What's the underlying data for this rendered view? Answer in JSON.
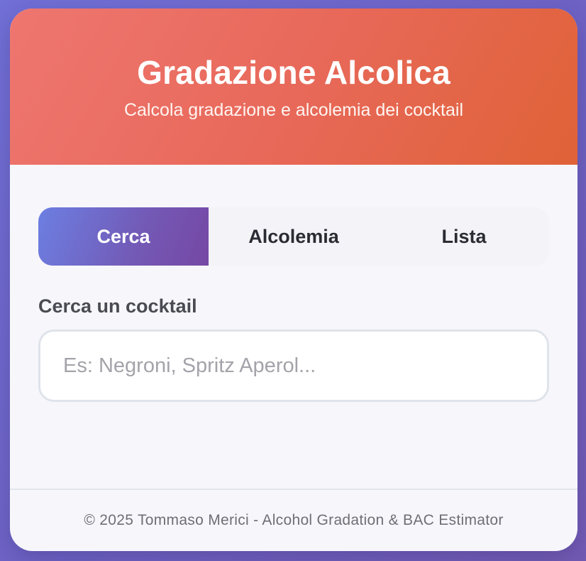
{
  "header": {
    "title": "Gradazione Alcolica",
    "subtitle": "Calcola gradazione e alcolemia dei cocktail"
  },
  "tabs": [
    {
      "label": "Cerca",
      "active": true
    },
    {
      "label": "Alcolemia",
      "active": false
    },
    {
      "label": "Lista",
      "active": false
    }
  ],
  "search": {
    "label": "Cerca un cocktail",
    "placeholder": "Es: Negroni, Spritz Aperol...",
    "value": ""
  },
  "footer": {
    "text": "© 2025 Tommaso Merici - Alcohol Gradation & BAC Estimator"
  },
  "colors": {
    "header_gradient_start": "#ee7670",
    "header_gradient_end": "#df6237",
    "active_tab_start": "#6c7fe2",
    "active_tab_end": "#7548a4",
    "background": "#6e62c4"
  }
}
